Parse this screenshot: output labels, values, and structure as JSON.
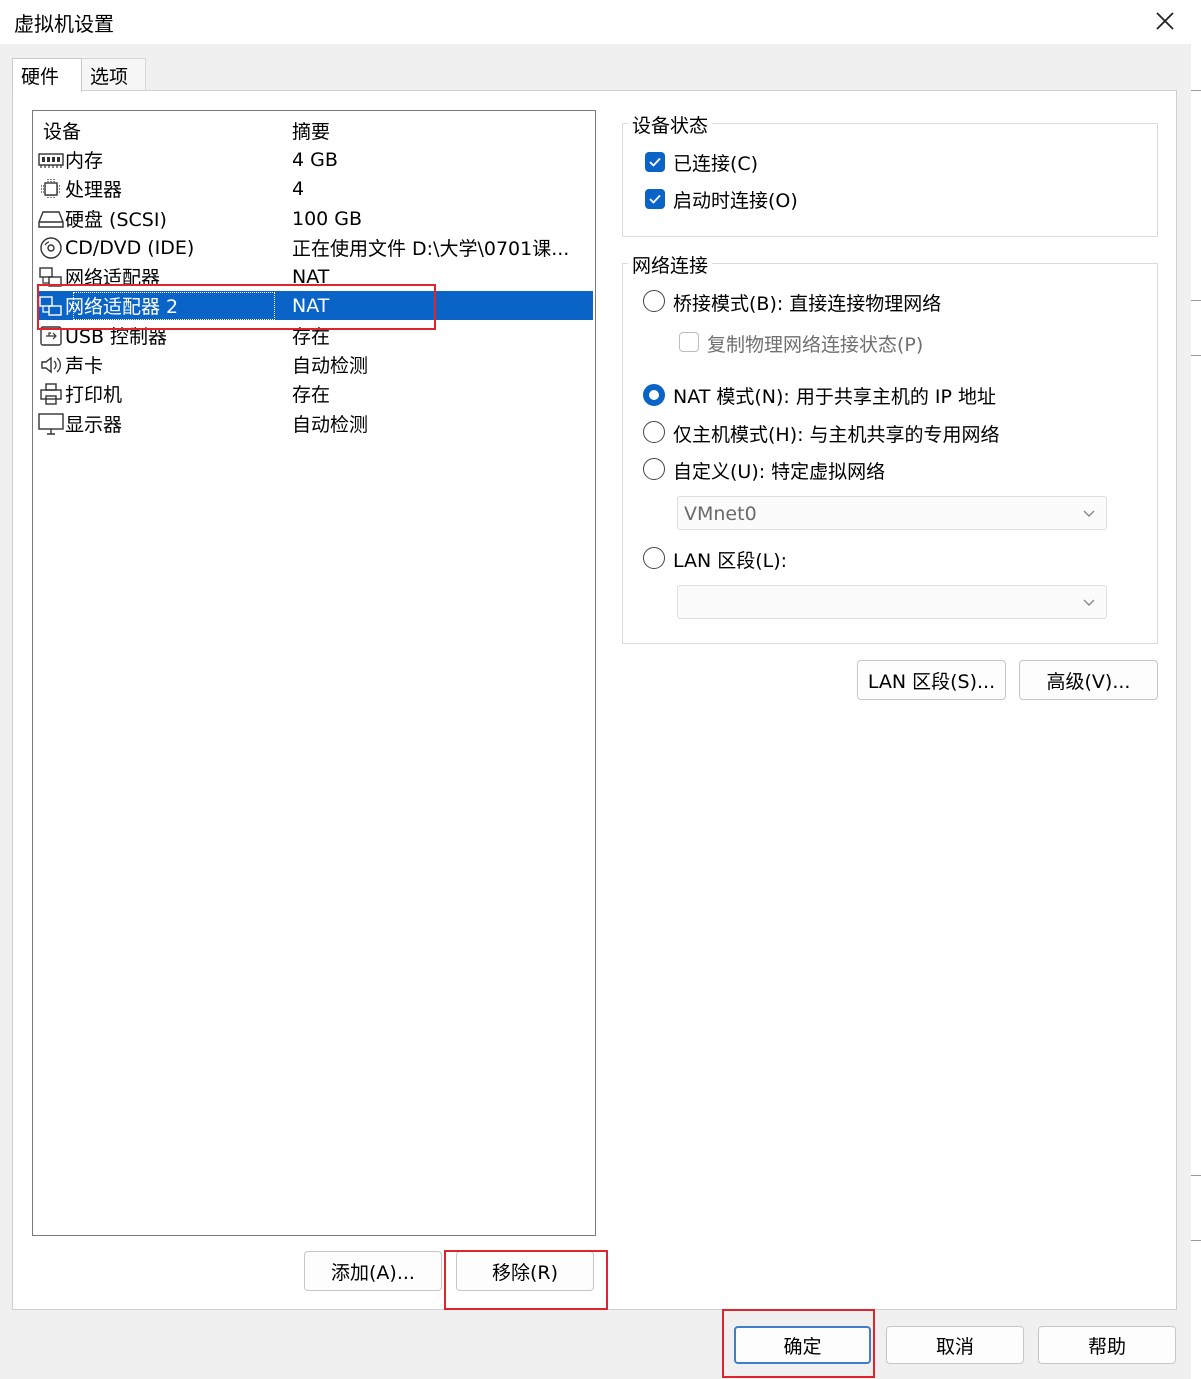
{
  "window": {
    "title": "虚拟机设置"
  },
  "tabs": [
    {
      "label": "硬件",
      "active": true
    },
    {
      "label": "选项",
      "active": false
    }
  ],
  "device_list": {
    "headers": {
      "device": "设备",
      "summary": "摘要"
    },
    "rows": [
      {
        "name": "内存",
        "summary": "4 GB",
        "icon": "memory-icon"
      },
      {
        "name": "处理器",
        "summary": "4",
        "icon": "processor-icon"
      },
      {
        "name": "硬盘 (SCSI)",
        "summary": "100 GB",
        "icon": "hard-disk-icon"
      },
      {
        "name": "CD/DVD (IDE)",
        "summary": "正在使用文件 D:\\大学\\0701课...",
        "icon": "cd-dvd-icon"
      },
      {
        "name": "网络适配器",
        "summary": "NAT",
        "icon": "network-adapter-icon"
      },
      {
        "name": "网络适配器 2",
        "summary": "NAT",
        "icon": "network-adapter-icon",
        "selected": true
      },
      {
        "name": "USB 控制器",
        "summary": "存在",
        "icon": "usb-controller-icon"
      },
      {
        "name": "声卡",
        "summary": "自动检测",
        "icon": "sound-card-icon"
      },
      {
        "name": "打印机",
        "summary": "存在",
        "icon": "printer-icon"
      },
      {
        "name": "显示器",
        "summary": "自动检测",
        "icon": "display-icon"
      }
    ]
  },
  "device_buttons": {
    "add": "添加(A)...",
    "remove": "移除(R)"
  },
  "device_status": {
    "title": "设备状态",
    "connected": {
      "label": "已连接(C)",
      "checked": true
    },
    "connect_at_power_on": {
      "label": "启动时连接(O)",
      "checked": true
    }
  },
  "network_connection": {
    "title": "网络连接",
    "bridged": {
      "label": "桥接模式(B): 直接连接物理网络",
      "selected": false
    },
    "replicate": {
      "label": "复制物理网络连接状态(P)",
      "checked": false
    },
    "nat": {
      "label": "NAT 模式(N): 用于共享主机的 IP 地址",
      "selected": true
    },
    "host_only": {
      "label": "仅主机模式(H): 与主机共享的专用网络",
      "selected": false
    },
    "custom": {
      "label": "自定义(U): 特定虚拟网络",
      "selected": false
    },
    "custom_select": {
      "value": "VMnet0"
    },
    "lan_segment": {
      "label": "LAN 区段(L):",
      "selected": false
    },
    "lan_select": {
      "value": ""
    }
  },
  "network_buttons": {
    "lan_segments": "LAN 区段(S)...",
    "advanced": "高级(V)..."
  },
  "dialog_buttons": {
    "ok": "确定",
    "cancel": "取消",
    "help": "帮助"
  },
  "colors": {
    "accent": "#0a64c8",
    "highlight": "#e0242b"
  }
}
